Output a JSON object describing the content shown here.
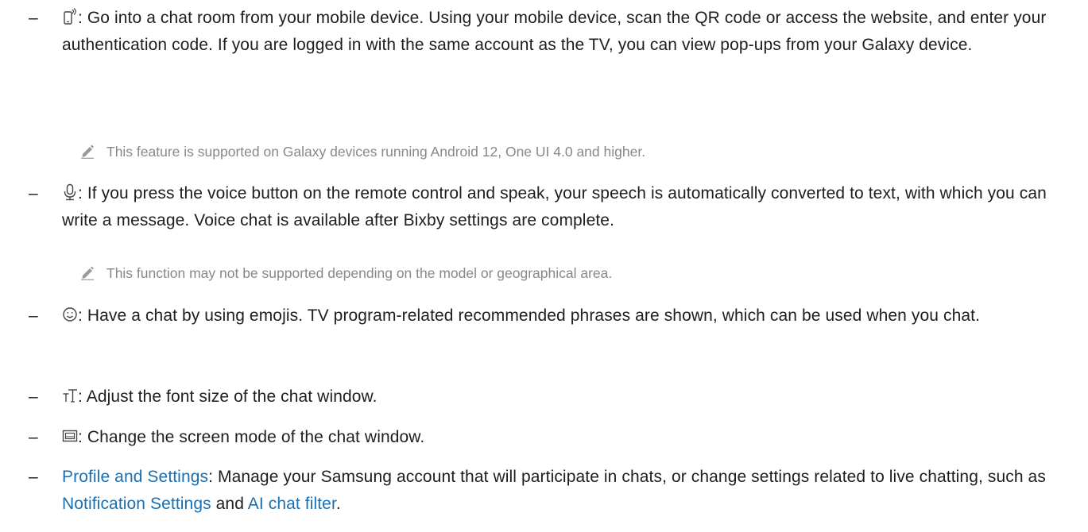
{
  "items": [
    {
      "dash": "–",
      "icon": "mobile-connect-icon",
      "text": ": Go into a chat room from your mobile device. Using your mobile device, scan the QR code or access the website, and enter your authentication code. If you are logged in with the same account as the TV, you can view pop-ups from your Galaxy device.",
      "note": "This feature is supported on Galaxy devices running Android 12, One UI 4.0 and higher."
    },
    {
      "dash": "–",
      "icon": "microphone-icon",
      "text": ": If you press the voice button on the remote control and speak, your speech is automatically converted to text, with which you can write a message. Voice chat is available after Bixby settings are complete.",
      "note": "This function may not be supported depending on the model or geographical area."
    },
    {
      "dash": "–",
      "icon": "emoji-icon",
      "text": ": Have a chat by using emojis. TV program-related recommended phrases are shown, which can be used when you chat."
    },
    {
      "dash": "–",
      "icon": "font-size-icon",
      "text": ": Adjust the font size of the chat window."
    },
    {
      "dash": "–",
      "icon": "screen-mode-icon",
      "text": ": Change the screen mode of the chat window."
    },
    {
      "dash": "–",
      "link1": "Profile and Settings",
      "text_a": ": Manage your Samsung account that will participate in chats, or change settings related to live chatting, such as ",
      "link2": "Notification Settings",
      "text_b": " and ",
      "link3": "AI chat filter",
      "text_c": "."
    }
  ],
  "colors": {
    "text": "#1e1e1e",
    "note": "#888888",
    "link": "#1a6fb0"
  }
}
